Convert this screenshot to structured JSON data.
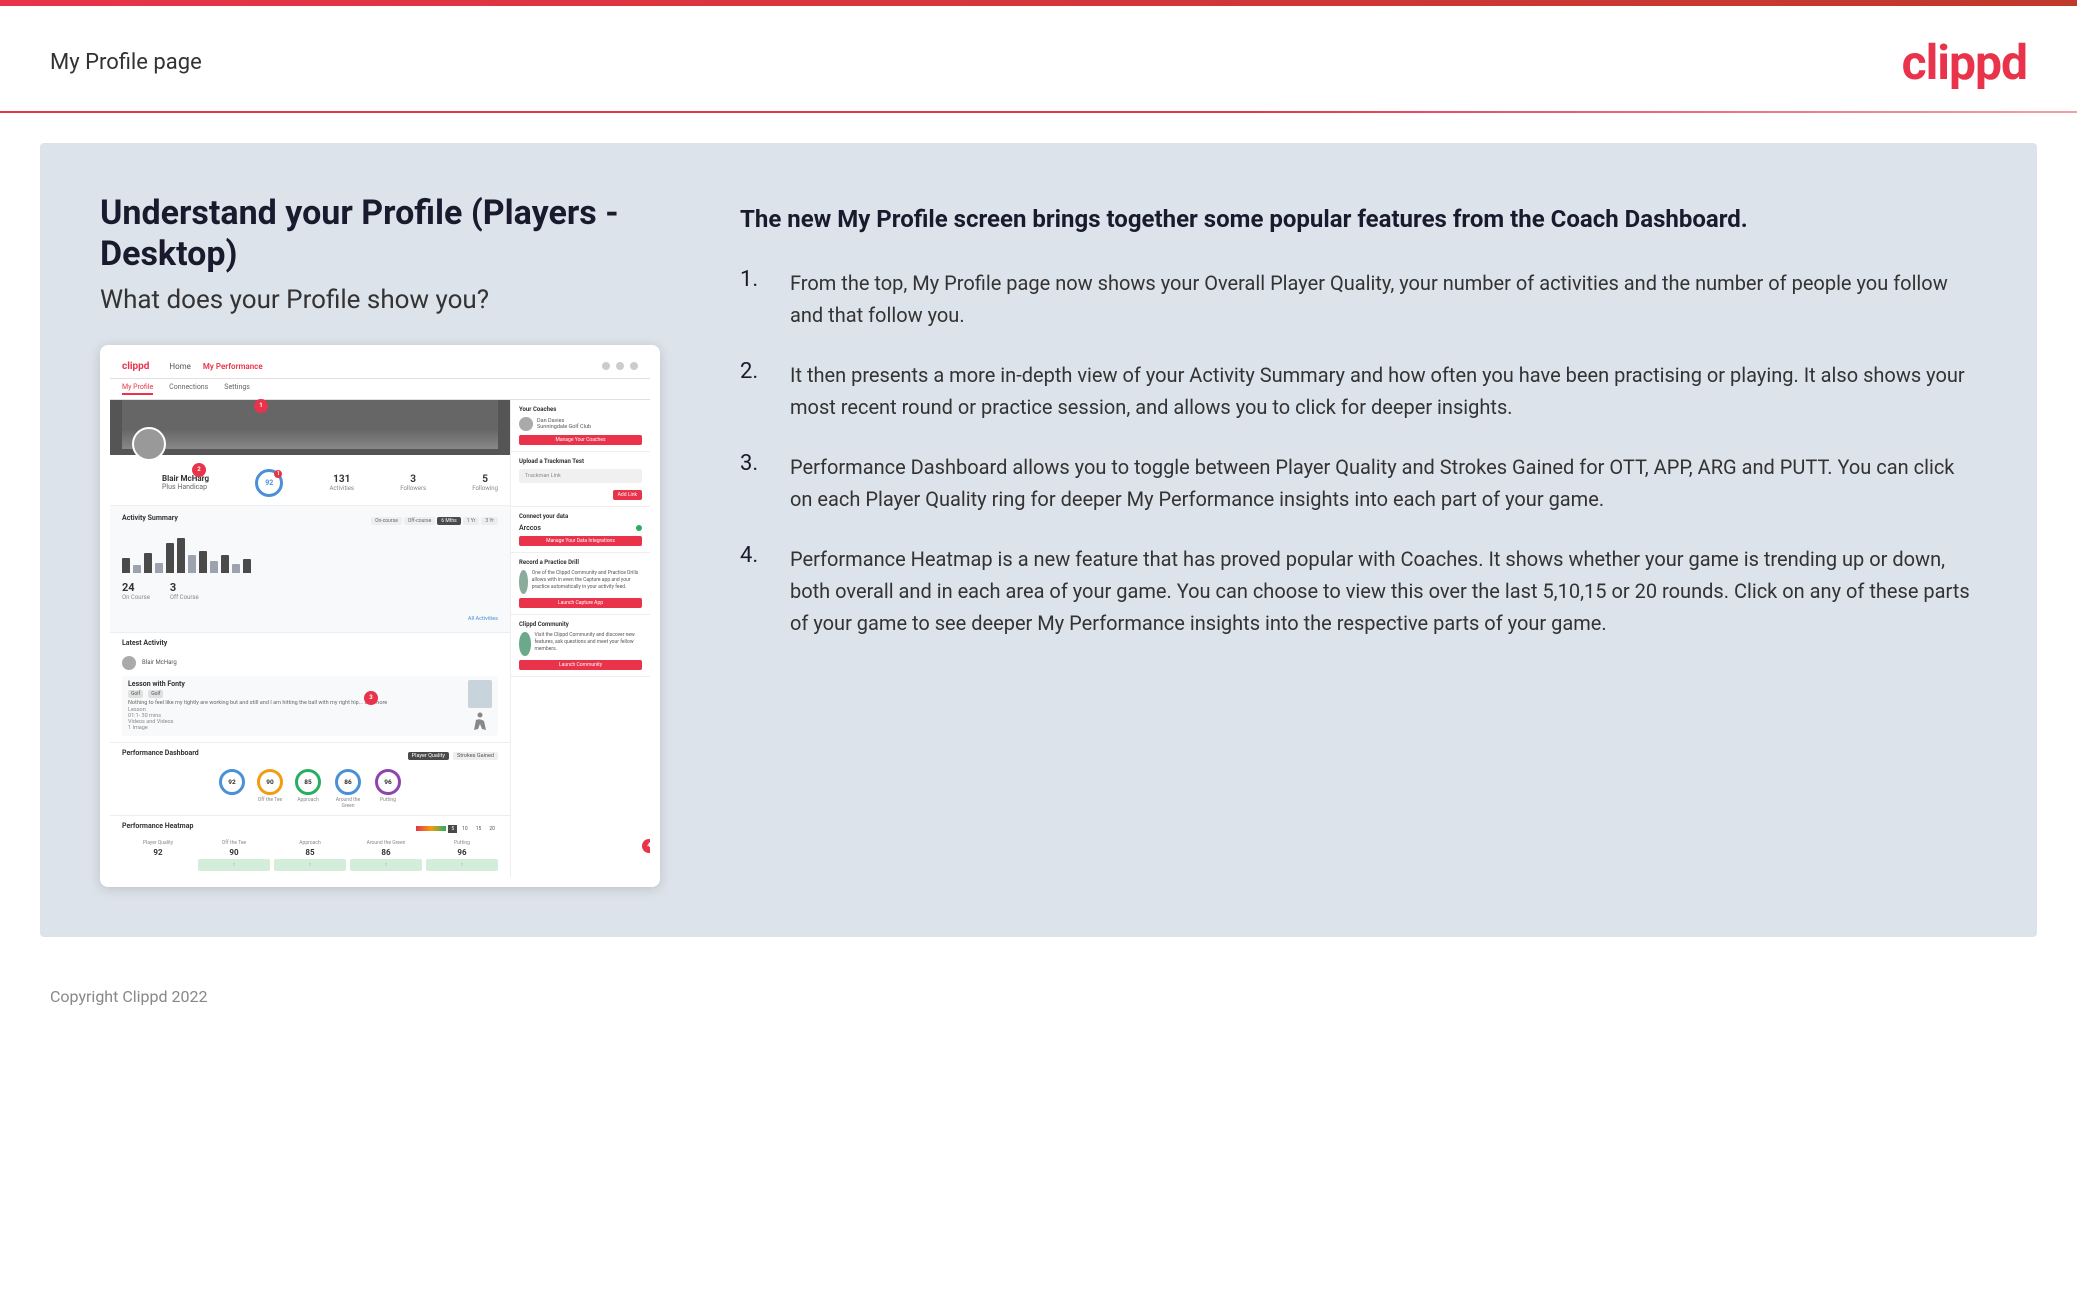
{
  "header": {
    "title": "My Profile page",
    "logo": "clippd"
  },
  "main": {
    "section_title": "Understand your Profile (Players - Desktop)",
    "section_subtitle": "What does your Profile show you?",
    "right_intro": "The new My Profile screen brings together some popular features from the Coach Dashboard.",
    "numbered_items": [
      {
        "number": "1.",
        "text": "From the top, My Profile page now shows your Overall Player Quality, your number of activities and the number of people you follow and that follow you."
      },
      {
        "number": "2.",
        "text": "It then presents a more in-depth view of your Activity Summary and how often you have been practising or playing. It also shows your most recent round or practice session, and allows you to click for deeper insights."
      },
      {
        "number": "3.",
        "text": "Performance Dashboard allows you to toggle between Player Quality and Strokes Gained for OTT, APP, ARG and PUTT. You can click on each Player Quality ring for deeper My Performance insights into each part of your game."
      },
      {
        "number": "4.",
        "text": "Performance Heatmap is a new feature that has proved popular with Coaches. It shows whether your game is trending up or down, both overall and in each area of your game. You can choose to view this over the last 5,10,15 or 20 rounds. Click on any of these parts of your game to see deeper My Performance insights into the respective parts of your game."
      }
    ]
  },
  "mock_data": {
    "nav": {
      "logo": "clippd",
      "home": "Home",
      "my_performance": "My Performance"
    },
    "subnav": {
      "my_profile": "My Profile",
      "connections": "Connections",
      "settings": "Settings"
    },
    "player": {
      "name": "Blair McHarg",
      "handicap": "Plus Handicap",
      "quality": "92",
      "activities": "131",
      "followers": "3",
      "following": "5"
    },
    "activity": {
      "title": "Activity Summary",
      "on_course": "24",
      "off_course": "3"
    },
    "performance": {
      "rings": [
        {
          "value": "92",
          "label": ""
        },
        {
          "value": "90",
          "label": "Off the Tee"
        },
        {
          "value": "85",
          "label": "Approach"
        },
        {
          "value": "86",
          "label": "Around the Green"
        },
        {
          "value": "96",
          "label": "Putting"
        }
      ]
    },
    "heatmap": {
      "values": [
        "92",
        "90",
        "85",
        "86",
        "96"
      ]
    },
    "sidebar": {
      "coaches_title": "Your Coaches",
      "coach_name": "Dan Davies",
      "coach_club": "Sunningdale Golf Club",
      "manage_btn": "Manage Your Coaches",
      "trackman_title": "Upload a Trackman Test",
      "trackman_placeholder": "Trackman Link",
      "connect_title": "Connect your data",
      "arccos": "Arccos",
      "community_title": "Clippd Community",
      "community_btn": "Launch Community",
      "record_title": "Record a Practice Drill",
      "record_btn": "Launch Capture App"
    }
  },
  "footer": {
    "copyright": "Copyright Clippd 2022"
  }
}
